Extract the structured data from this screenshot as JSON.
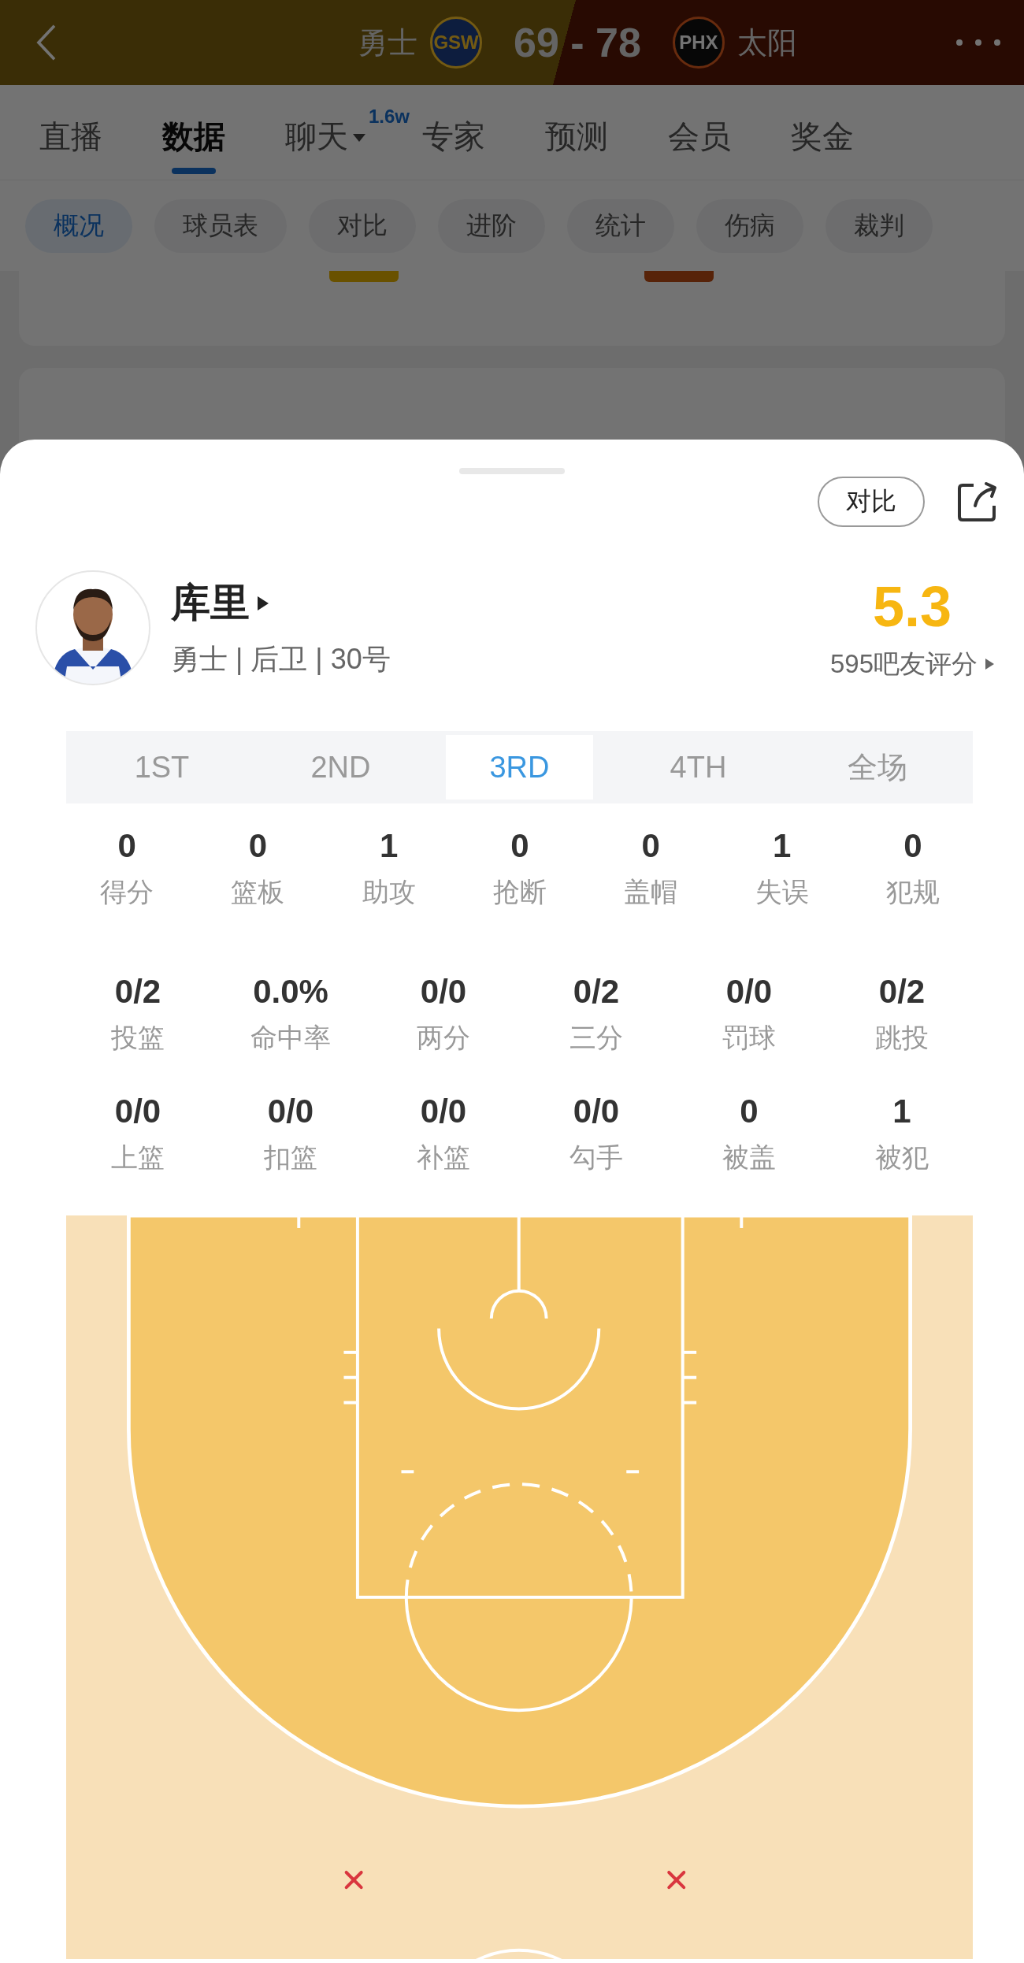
{
  "header": {
    "home": {
      "name": "勇士",
      "abbr": "GSW"
    },
    "score": "69 - 78",
    "away": {
      "name": "太阳",
      "abbr": "PHX"
    }
  },
  "tabs": [
    {
      "label": "直播",
      "selected": false
    },
    {
      "label": "数据",
      "selected": true
    },
    {
      "label": "聊天",
      "selected": false,
      "dropdown": true,
      "badge": "1.6w"
    },
    {
      "label": "专家",
      "selected": false
    },
    {
      "label": "预测",
      "selected": false
    },
    {
      "label": "会员",
      "selected": false
    },
    {
      "label": "奖金",
      "selected": false
    }
  ],
  "subtabs": [
    {
      "label": "概况",
      "selected": true
    },
    {
      "label": "球员表",
      "selected": false
    },
    {
      "label": "对比",
      "selected": false
    },
    {
      "label": "进阶",
      "selected": false
    },
    {
      "label": "统计",
      "selected": false
    },
    {
      "label": "伤病",
      "selected": false
    },
    {
      "label": "裁判",
      "selected": false
    }
  ],
  "player": {
    "compare_button": "对比",
    "name": "库里",
    "team_info": "勇士 | 后卫 | 30号",
    "rating": "5.3",
    "rating_count": "595吧友评分"
  },
  "periods": [
    {
      "label": "1ST",
      "selected": false
    },
    {
      "label": "2ND",
      "selected": false
    },
    {
      "label": "3RD",
      "selected": true
    },
    {
      "label": "4TH",
      "selected": false
    },
    {
      "label": "全场",
      "selected": false
    }
  ],
  "stats_main": [
    {
      "value": "0",
      "label": "得分"
    },
    {
      "value": "0",
      "label": "篮板"
    },
    {
      "value": "1",
      "label": "助攻"
    },
    {
      "value": "0",
      "label": "抢断"
    },
    {
      "value": "0",
      "label": "盖帽"
    },
    {
      "value": "1",
      "label": "失误"
    },
    {
      "value": "0",
      "label": "犯规"
    }
  ],
  "stats_shooting": [
    {
      "value": "0/2",
      "label": "投篮"
    },
    {
      "value": "0.0%",
      "label": "命中率"
    },
    {
      "value": "0/0",
      "label": "两分"
    },
    {
      "value": "0/2",
      "label": "三分"
    },
    {
      "value": "0/0",
      "label": "罚球"
    },
    {
      "value": "0/2",
      "label": "跳投"
    },
    {
      "value": "0/0",
      "label": "上篮"
    },
    {
      "value": "0/0",
      "label": "扣篮"
    },
    {
      "value": "0/0",
      "label": "补篮"
    },
    {
      "value": "0/0",
      "label": "勾手"
    },
    {
      "value": "0",
      "label": "被盖"
    },
    {
      "value": "1",
      "label": "被犯"
    }
  ]
}
